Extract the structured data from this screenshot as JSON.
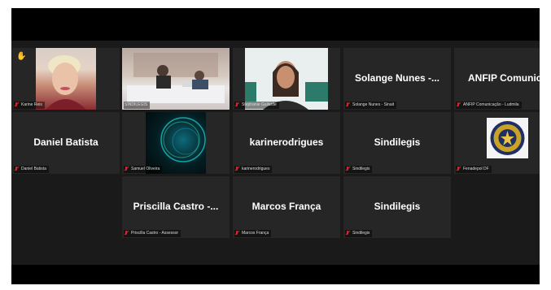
{
  "participants": [
    {
      "id": "p1",
      "display": "video",
      "label": "Karine Reis",
      "hand_raised": true
    },
    {
      "id": "p2",
      "display": "video",
      "label": "SINDILEGIS",
      "active_speaker": true
    },
    {
      "id": "p3",
      "display": "video",
      "label": "Stephanie Guilarde"
    },
    {
      "id": "p4",
      "display": "name",
      "big_name": "Solange Nunes -...",
      "label": "Solange Nunes - Sinait"
    },
    {
      "id": "p5",
      "display": "name",
      "big_name": "ANFIP Comunic...",
      "label": "ANFIP Comunicação - Ludmila"
    },
    {
      "id": "p6",
      "display": "name",
      "big_name": "Daniel Batista",
      "label": "Daniel Batista"
    },
    {
      "id": "p7",
      "display": "video",
      "label": "Samuel Oliveira"
    },
    {
      "id": "p8",
      "display": "name",
      "big_name": "karinerodrigues",
      "label": "karinerodrigues"
    },
    {
      "id": "p9",
      "display": "name",
      "big_name": "Sindilegis",
      "label": "Sindilegis"
    },
    {
      "id": "p10",
      "display": "logo",
      "label": "Fenadepol DF"
    },
    {
      "id": "p11",
      "display": "name",
      "big_name": "Priscilla Castro -...",
      "label": "Priscilla Castro - Assessor"
    },
    {
      "id": "p12",
      "display": "name",
      "big_name": "Marcos França",
      "label": "Marcos França"
    },
    {
      "id": "p13",
      "display": "name",
      "big_name": "Sindilegis",
      "label": "Sindilegis"
    }
  ],
  "mic_state": "muted",
  "colors": {
    "active_speaker_border": "#c9d84a",
    "muted_mic": "#e02424",
    "raised_hand": "#f2b21b"
  }
}
